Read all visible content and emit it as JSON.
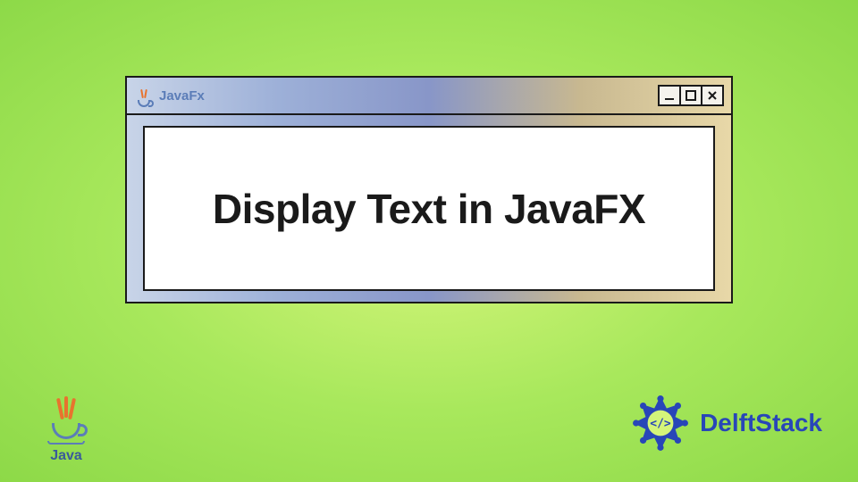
{
  "window": {
    "title_text": "JavaFx",
    "main_content": "Display Text in JavaFX"
  },
  "footer": {
    "java_label": "Java",
    "brand_name": "DelftStack"
  },
  "colors": {
    "accent_blue": "#2846b8",
    "java_orange": "#e8732e",
    "java_blue": "#5b7db8"
  }
}
